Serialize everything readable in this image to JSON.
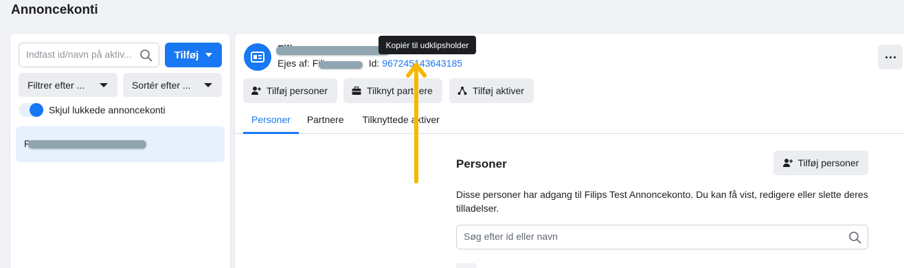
{
  "page": {
    "title": "Annoncekonti"
  },
  "sidebar": {
    "search_placeholder": "Indtast id/navn på aktiv...",
    "add_label": "Tilføj",
    "filter_label": "Filtrer efter ...",
    "sort_label": "Sortér efter ...",
    "toggle_label": "Skjul lukkede annoncekonti",
    "toggle_on": true,
    "selected_account_prefix": "F"
  },
  "account": {
    "name_prefix": "Fili",
    "owner_label": "Ejes af:",
    "owner_prefix": "Fili",
    "id_label": "Id:",
    "id_value": "967245143643185"
  },
  "tooltip": {
    "text": "Kopiér til udklipsholder"
  },
  "actions": [
    {
      "label": "Tilføj personer",
      "icon": "add-person-icon"
    },
    {
      "label": "Tilknyt partnere",
      "icon": "briefcase-icon"
    },
    {
      "label": "Tilføj aktiver",
      "icon": "assets-icon"
    }
  ],
  "tabs": [
    {
      "label": "Personer",
      "active": true
    },
    {
      "label": "Partnere",
      "active": false
    },
    {
      "label": "Tilknyttede aktiver",
      "active": false
    }
  ],
  "people_section": {
    "title": "Personer",
    "add_label": "Tilføj personer",
    "description": "Disse personer har adgang til Filips Test Annoncekonto. Du kan få vist, redigere eller slette deres tilladelser.",
    "search_placeholder": "Søg efter id eller navn"
  },
  "colors": {
    "accent": "#1877f2",
    "background": "#f0f2f5",
    "annotation_arrow": "#f5b800"
  }
}
